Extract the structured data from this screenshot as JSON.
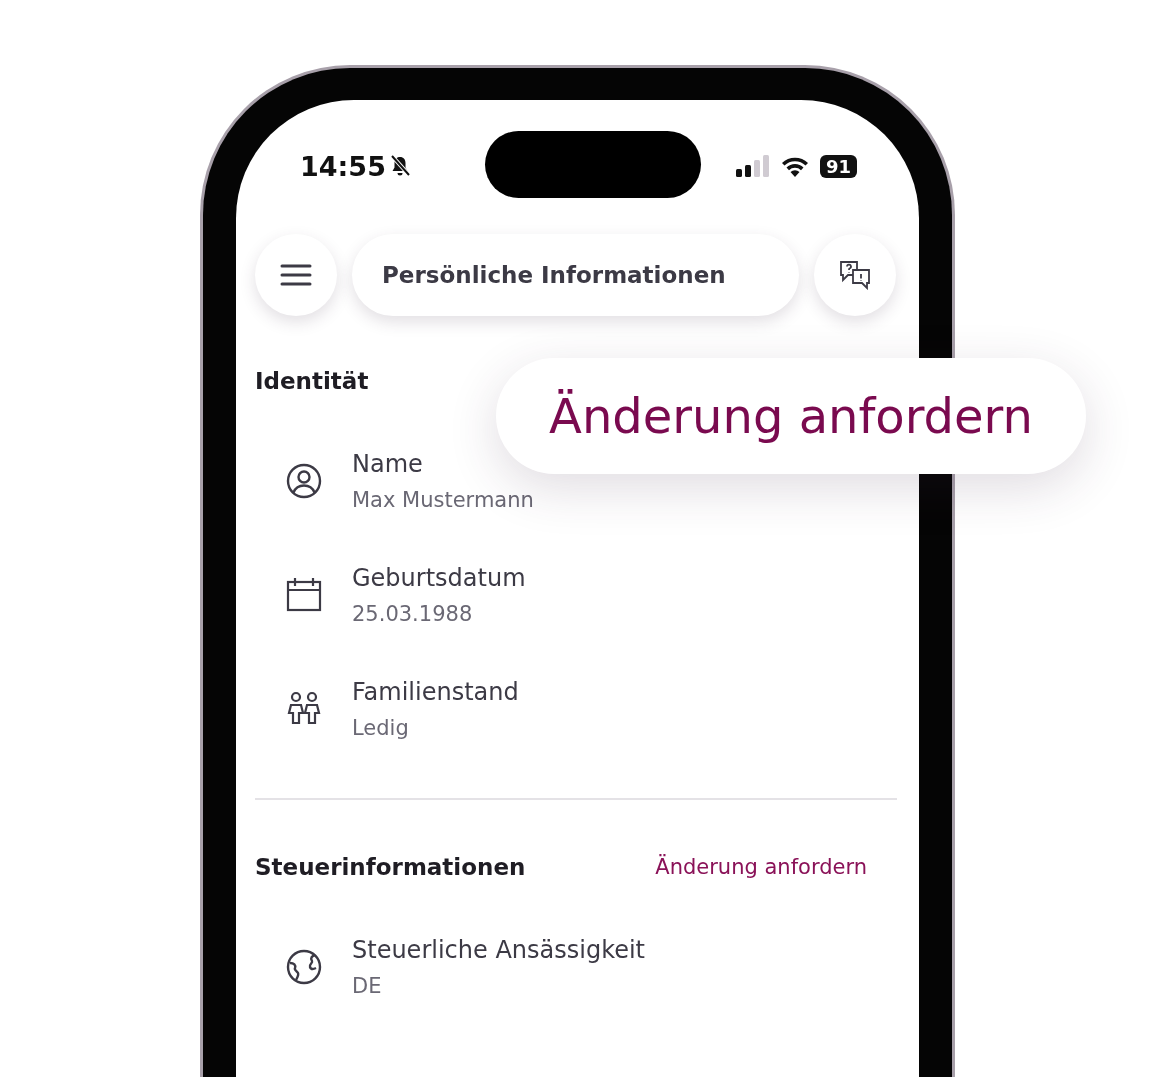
{
  "status_bar": {
    "time": "14:55",
    "battery": "91"
  },
  "header": {
    "title": "Persönliche Informationen"
  },
  "sections": [
    {
      "title": "Identität",
      "fields": [
        {
          "kind": "person",
          "label": "Name",
          "value": "Max Mustermann"
        },
        {
          "kind": "calendar",
          "label": "Geburtsdatum",
          "value": "25.03.1988"
        },
        {
          "kind": "people",
          "label": "Familienstand",
          "value": "Ledig"
        }
      ]
    },
    {
      "title": "Steuerinformationen",
      "action": "Änderung anfordern",
      "fields": [
        {
          "kind": "globe",
          "label": "Steuerliche Ansässigkeit",
          "value": "DE"
        }
      ]
    }
  ],
  "callout": {
    "text": "Änderung anfordern"
  }
}
